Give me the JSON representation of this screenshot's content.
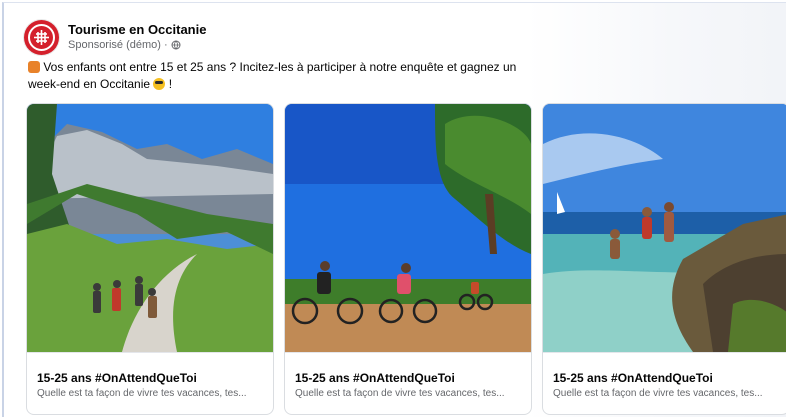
{
  "header": {
    "page_name": "Tourisme en Occitanie",
    "sponsored": "Sponsorisé (démo) ·"
  },
  "post": {
    "text_line1": "Vos enfants ont entre 15 et 25 ans ? Incitez-les à participer à notre enquête et gagnez un",
    "text_line2": "week-end en Occitanie",
    "text_end": "!"
  },
  "cards": [
    {
      "title": "15-25 ans #OnAttendQueToi",
      "description": "Quelle est ta façon de vivre tes vacances, tes..."
    },
    {
      "title": "15-25 ans #OnAttendQueToi",
      "description": "Quelle est ta façon de vivre tes vacances, tes..."
    },
    {
      "title": "15-25 ans #OnAttendQueToi",
      "description": "Quelle est ta façon de vivre tes vacances, tes..."
    }
  ],
  "icons": {
    "logo": "occitanie-cross-logo",
    "privacy": "globe-icon",
    "emoji1": "gift-emoji",
    "emoji2": "sunglasses-emoji"
  },
  "colors": {
    "brand": "#d4202c",
    "secondary_text": "#65676b"
  }
}
